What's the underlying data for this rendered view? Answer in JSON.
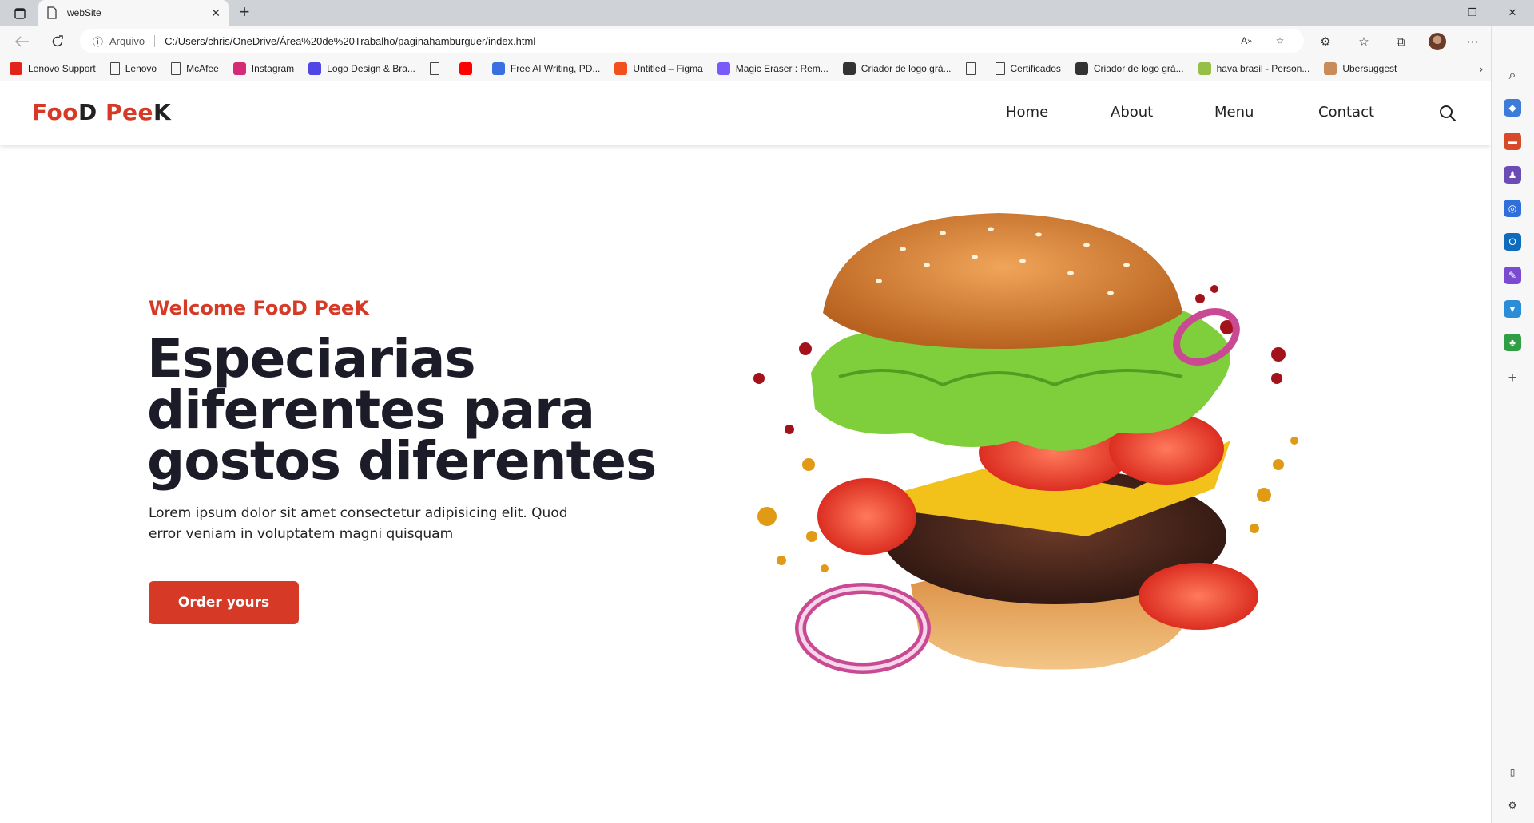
{
  "browser": {
    "tab_title": "webSite",
    "address_label": "Arquivo",
    "url": "C:/Users/chris/OneDrive/Área%20de%20Trabalho/paginahamburguer/index.html",
    "bookmarks": [
      {
        "label": "Lenovo Support",
        "icon": "lenovo-icon",
        "color": "#e2231a"
      },
      {
        "label": "Lenovo",
        "icon": "page-icon",
        "color": ""
      },
      {
        "label": "McAfee",
        "icon": "page-icon",
        "color": ""
      },
      {
        "label": "Instagram",
        "icon": "instagram-icon",
        "color": "#d62976"
      },
      {
        "label": "Logo Design & Bra...",
        "icon": "logo-design-icon",
        "color": "#5046e5"
      },
      {
        "label": "",
        "icon": "page-icon",
        "color": ""
      },
      {
        "label": "",
        "icon": "youtube-icon",
        "color": "#ff0000"
      },
      {
        "label": "Free AI Writing, PD...",
        "icon": "ai-writing-icon",
        "color": "#3b6fe0"
      },
      {
        "label": "Untitled – Figma",
        "icon": "figma-icon",
        "color": "#f24e1e"
      },
      {
        "label": "Magic Eraser : Rem...",
        "icon": "magic-eraser-icon",
        "color": "#7a5af8"
      },
      {
        "label": "Criador de logo grá...",
        "icon": "logo-maker-icon",
        "color": "#333333"
      },
      {
        "label": "",
        "icon": "page-icon",
        "color": ""
      },
      {
        "label": "Certificados",
        "icon": "page-icon",
        "color": ""
      },
      {
        "label": "Criador de logo grá...",
        "icon": "logo-maker-icon",
        "color": "#333333"
      },
      {
        "label": "hava brasil - Person...",
        "icon": "shopify-icon",
        "color": "#95bf47"
      },
      {
        "label": "Ubersuggest",
        "icon": "ubersuggest-icon",
        "color": "#c98b5a"
      }
    ]
  },
  "site": {
    "logo": {
      "part1": "Foo",
      "part2": "D ",
      "part3": "Pee",
      "part4": "K"
    },
    "nav": {
      "home": "Home",
      "about": "About",
      "menu": "Menu",
      "contact": "Contact"
    },
    "hero": {
      "subtitle": "Welcome FooD PeeK",
      "title": "Especiarias diferentes para gostos diferentes",
      "text": "Lorem ipsum dolor sit amet consectetur adipisicing elit. Quod error veniam in voluptatem magni quisquam",
      "cta": "Order yours"
    }
  },
  "colors": {
    "accent": "#d63a26",
    "title": "#1c1c28"
  }
}
